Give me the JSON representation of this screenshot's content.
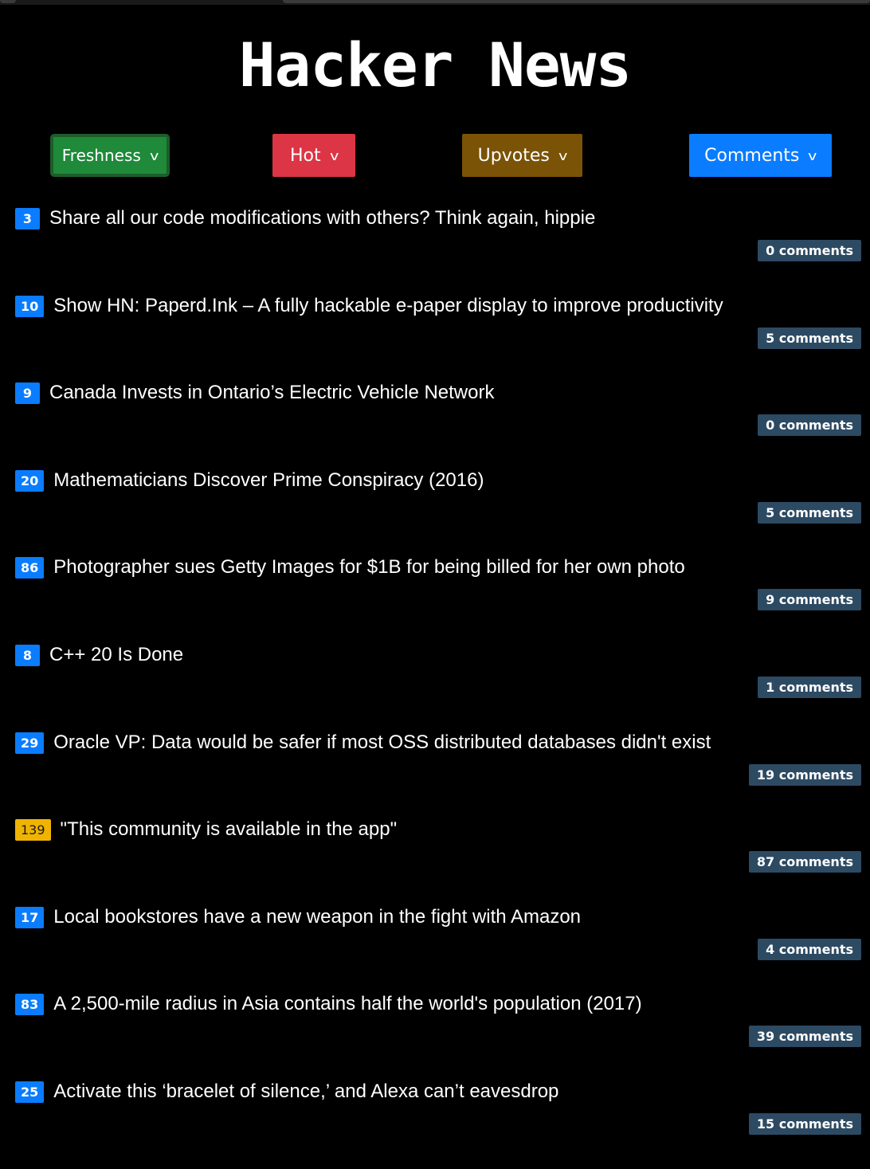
{
  "app": {
    "title": "Hacker News"
  },
  "sort_buttons": [
    {
      "label": "Freshness",
      "chevron": "v",
      "color": "#1e8a3a"
    },
    {
      "label": "Hot",
      "chevron": "v",
      "color": "#dc3545"
    },
    {
      "label": "Upvotes",
      "chevron": "v",
      "color": "#7a5306"
    },
    {
      "label": "Comments",
      "chevron": "v",
      "color": "#0a7cff"
    }
  ],
  "colors": {
    "background": "#000000",
    "score_badge": "#0a7cff",
    "score_badge_hot": "#f0b400",
    "comments_badge": "#2d4a63"
  },
  "stories": [
    {
      "score": "3",
      "title": "Share all our code modifications with others? Think again, hippie",
      "comments": "0 comments"
    },
    {
      "score": "10",
      "title": "Show HN: Paperd.Ink – A fully hackable e-paper display to improve productivity",
      "comments": "5 comments"
    },
    {
      "score": "9",
      "title": "Canada Invests in Ontario’s Electric Vehicle Network",
      "comments": "0 comments"
    },
    {
      "score": "20",
      "title": "Mathematicians Discover Prime Conspiracy (2016)",
      "comments": "5 comments"
    },
    {
      "score": "86",
      "title": "Photographer sues Getty Images for $1B for being billed for her own photo",
      "comments": "9 comments"
    },
    {
      "score": "8",
      "title": "C++ 20 Is Done",
      "comments": "1 comments"
    },
    {
      "score": "29",
      "title": "Oracle VP: Data would be safer if most OSS distributed databases didn't exist",
      "comments": "19 comments"
    },
    {
      "score": "139",
      "title": "\"This community is available in the app\"",
      "comments": "87 comments",
      "hot": true
    },
    {
      "score": "17",
      "title": "Local bookstores have a new weapon in the fight with Amazon",
      "comments": "4 comments"
    },
    {
      "score": "83",
      "title": "A 2,500-mile radius in Asia contains half the world's population (2017)",
      "comments": "39 comments"
    },
    {
      "score": "25",
      "title": "Activate this ‘bracelet of silence,’ and Alexa can’t eavesdrop",
      "comments": "15 comments"
    }
  ]
}
